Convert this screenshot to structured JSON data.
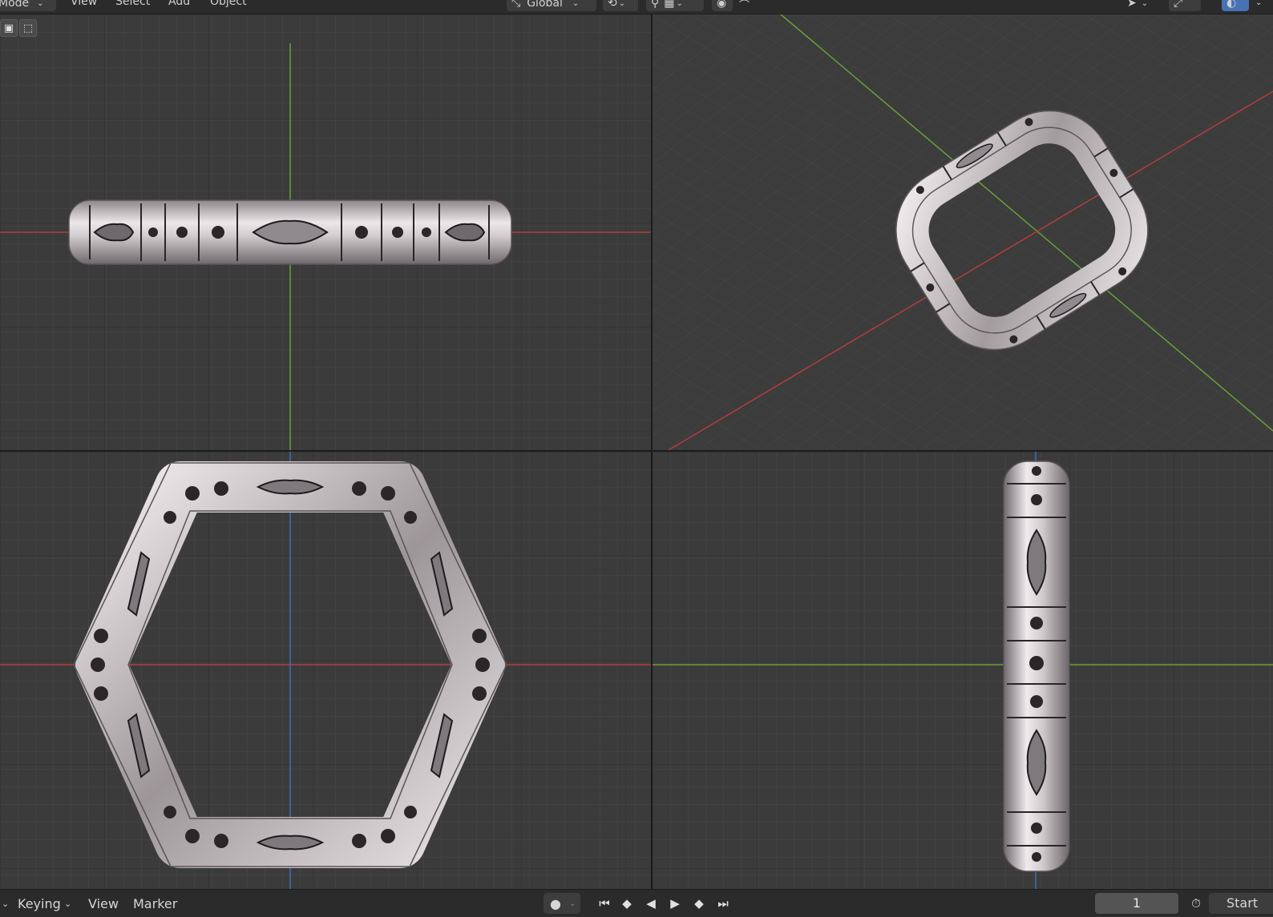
{
  "header": {
    "mode_label": "Mode",
    "menu": [
      "View",
      "Select",
      "Add",
      "Object"
    ],
    "transform_orientation": "Global",
    "icons": [
      "chevron-down-icon",
      "transform-orientation-icon",
      "link-icon",
      "snap-icon",
      "snap-increment-icon",
      "proportional-edit-icon",
      "falloff-icon",
      "select-cursor-icon",
      "gizmo-icon",
      "overlay-icon"
    ]
  },
  "toolbar_icons": [
    "select-box-icon",
    "select-mode-icon"
  ],
  "viewports": [
    {
      "name": "front-view"
    },
    {
      "name": "perspective-view"
    },
    {
      "name": "top-view"
    },
    {
      "name": "side-view"
    }
  ],
  "colors": {
    "x_axis": "#b43c3c",
    "y_axis": "#6a9e3a",
    "z_axis": "#3d6fb4",
    "active_button": "#4772b3",
    "ring_metal": "#b8b0b3"
  },
  "timeline": {
    "keying_label": "Keying",
    "view_label": "View",
    "marker_label": "Marker",
    "current_frame": "1",
    "start_label": "Start",
    "playback_icons": [
      "jump-to-start-icon",
      "previous-keyframe-icon",
      "play-reverse-icon",
      "play-icon",
      "next-keyframe-icon",
      "jump-to-end-icon"
    ]
  }
}
